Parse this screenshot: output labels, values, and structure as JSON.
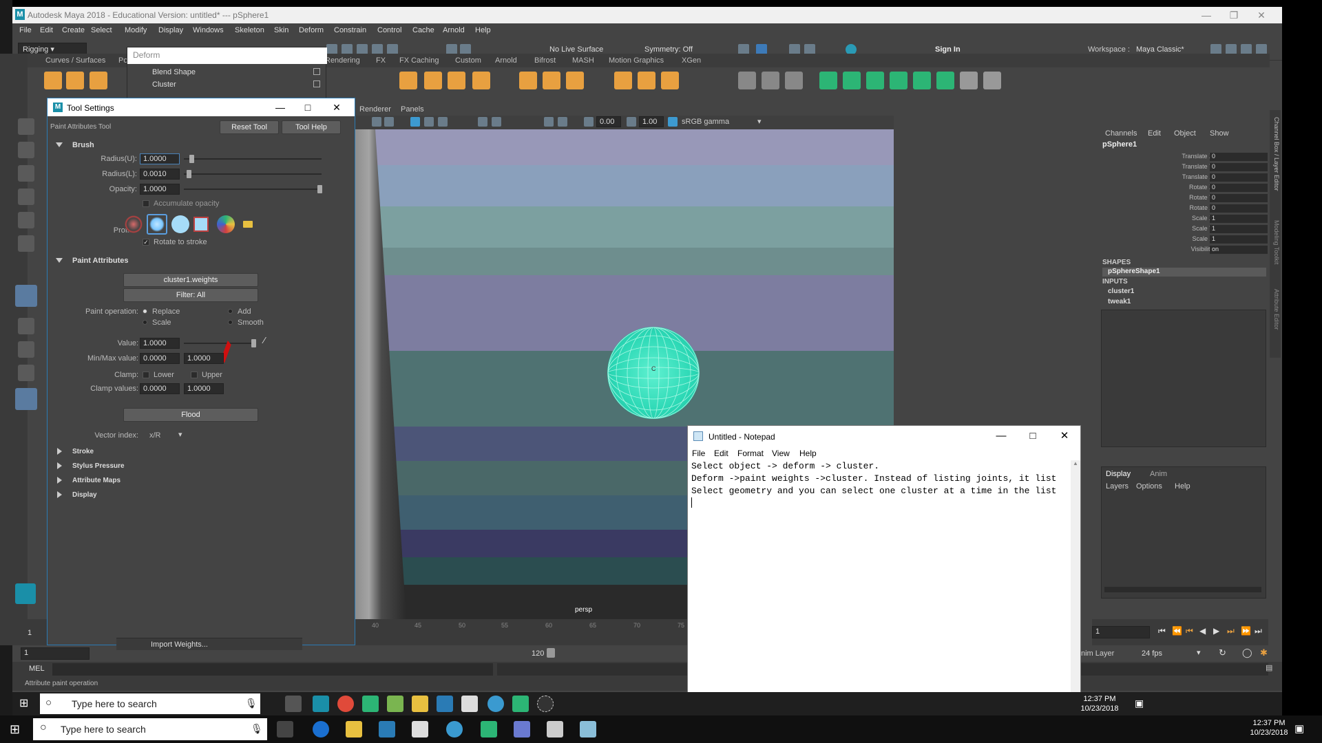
{
  "maya": {
    "title": "Autodesk Maya 2018 - Educational Version: untitled*   ---   pSphere1",
    "menu": [
      "File",
      "Edit",
      "Create",
      "Select",
      "Modify",
      "Display",
      "Windows",
      "Skeleton",
      "Skin",
      "Deform",
      "Constrain",
      "Control",
      "Cache",
      "Arnold",
      "Help"
    ],
    "mode": "Rigging",
    "no_live_surface": "No Live Surface",
    "symmetry": "Symmetry: Off",
    "sign_in": "Sign In",
    "workspace_label": "Workspace :",
    "workspace_value": "Maya Classic*",
    "shelf_tabs": [
      "Curves / Surfaces",
      "Po",
      "Rendering",
      "FX",
      "FX Caching",
      "Custom",
      "Arnold",
      "Bifrost",
      "MASH",
      "Motion Graphics",
      "XGen"
    ]
  },
  "deform_menu": {
    "search_placeholder": "Deform",
    "items": [
      "Blend Shape",
      "Cluster"
    ]
  },
  "viewport": {
    "menu": [
      "Renderer",
      "Panels"
    ],
    "exposure": "0.00",
    "gamma": "1.00",
    "colorspace": "sRGB gamma",
    "camera": "persp",
    "cluster_marker": "C"
  },
  "tool_settings": {
    "title": "Tool Settings",
    "tool_name": "Paint Attributes Tool",
    "reset_tool": "Reset Tool",
    "tool_help": "Tool Help",
    "brush_section": "Brush",
    "radius_u_label": "Radius(U):",
    "radius_u": "1.0000",
    "radius_l_label": "Radius(L):",
    "radius_l": "0.0010",
    "opacity_label": "Opacity:",
    "opacity": "1.0000",
    "accumulate_opacity": "Accumulate opacity",
    "profile_label": "Profile:",
    "rotate_to_stroke": "Rotate to stroke",
    "paint_attributes_section": "Paint Attributes",
    "attribute_button": "cluster1.weights",
    "filter_button": "Filter: All",
    "paint_operation_label": "Paint operation:",
    "op_replace": "Replace",
    "op_add": "Add",
    "op_scale": "Scale",
    "op_smooth": "Smooth",
    "value_label": "Value:",
    "value": "1.0000",
    "minmax_label": "Min/Max value:",
    "min": "0.0000",
    "max": "1.0000",
    "clamp_label": "Clamp:",
    "clamp_lower": "Lower",
    "clamp_upper": "Upper",
    "clamp_values_label": "Clamp values:",
    "clamp_min": "0.0000",
    "clamp_max": "1.0000",
    "flood": "Flood",
    "vector_index_label": "Vector index:",
    "vector_index": "x/R",
    "collapsed_sections": [
      "Stroke",
      "Stylus Pressure",
      "Attribute Maps",
      "Display"
    ],
    "import_weights": "Import Weights..."
  },
  "channel_box": {
    "menu": [
      "Channels",
      "Edit",
      "Object",
      "Show"
    ],
    "object": "pSphere1",
    "attrs": [
      {
        "label": "Translate X",
        "value": "0"
      },
      {
        "label": "Translate Y",
        "value": "0"
      },
      {
        "label": "Translate Z",
        "value": "0"
      },
      {
        "label": "Rotate X",
        "value": "0"
      },
      {
        "label": "Rotate Y",
        "value": "0"
      },
      {
        "label": "Rotate Z",
        "value": "0"
      },
      {
        "label": "Scale X",
        "value": "1"
      },
      {
        "label": "Scale Y",
        "value": "1"
      },
      {
        "label": "Scale Z",
        "value": "1"
      },
      {
        "label": "Visibility",
        "value": "on"
      }
    ],
    "shapes_header": "SHAPES",
    "shape": "pSphereShape1",
    "inputs_header": "INPUTS",
    "inputs": [
      "cluster1",
      "tweak1"
    ],
    "layer_tabs": [
      "Display",
      "Anim"
    ],
    "layer_menu": [
      "Layers",
      "Options",
      "Help"
    ],
    "side_tabs": [
      "Channel Box / Layer Editor",
      "Modeling Toolkit",
      "Attribute Editor"
    ]
  },
  "timeline": {
    "ticks": [
      "40",
      "45",
      "50",
      "55",
      "60",
      "65",
      "70",
      "75"
    ],
    "current_frame": "1",
    "start": "1",
    "end_value": "120",
    "frame_field": "1",
    "anim_layer": "nim Layer",
    "fps": "24 fps"
  },
  "command_line": {
    "mode": "MEL",
    "help_text": "Attribute paint operation"
  },
  "notepad": {
    "title": "Untitled - Notepad",
    "menu": [
      "File",
      "Edit",
      "Format",
      "View",
      "Help"
    ],
    "lines": [
      "Select object -> deform -> cluster.",
      "Deform ->paint weights ->cluster. Instead of listing joints, it list",
      "Select geometry and you can select one cluster at a time in the list"
    ]
  },
  "taskbar_inner": {
    "search": "Type here to search",
    "time": "12:37 PM",
    "date": "10/23/2018"
  },
  "taskbar_outer": {
    "search": "Type here to search",
    "time": "12:37 PM",
    "date": "10/23/2018"
  },
  "colors": {
    "maya_bg": "#444444",
    "sphere": "#2bd8b5",
    "selection_blue": "#2a7bb5"
  }
}
